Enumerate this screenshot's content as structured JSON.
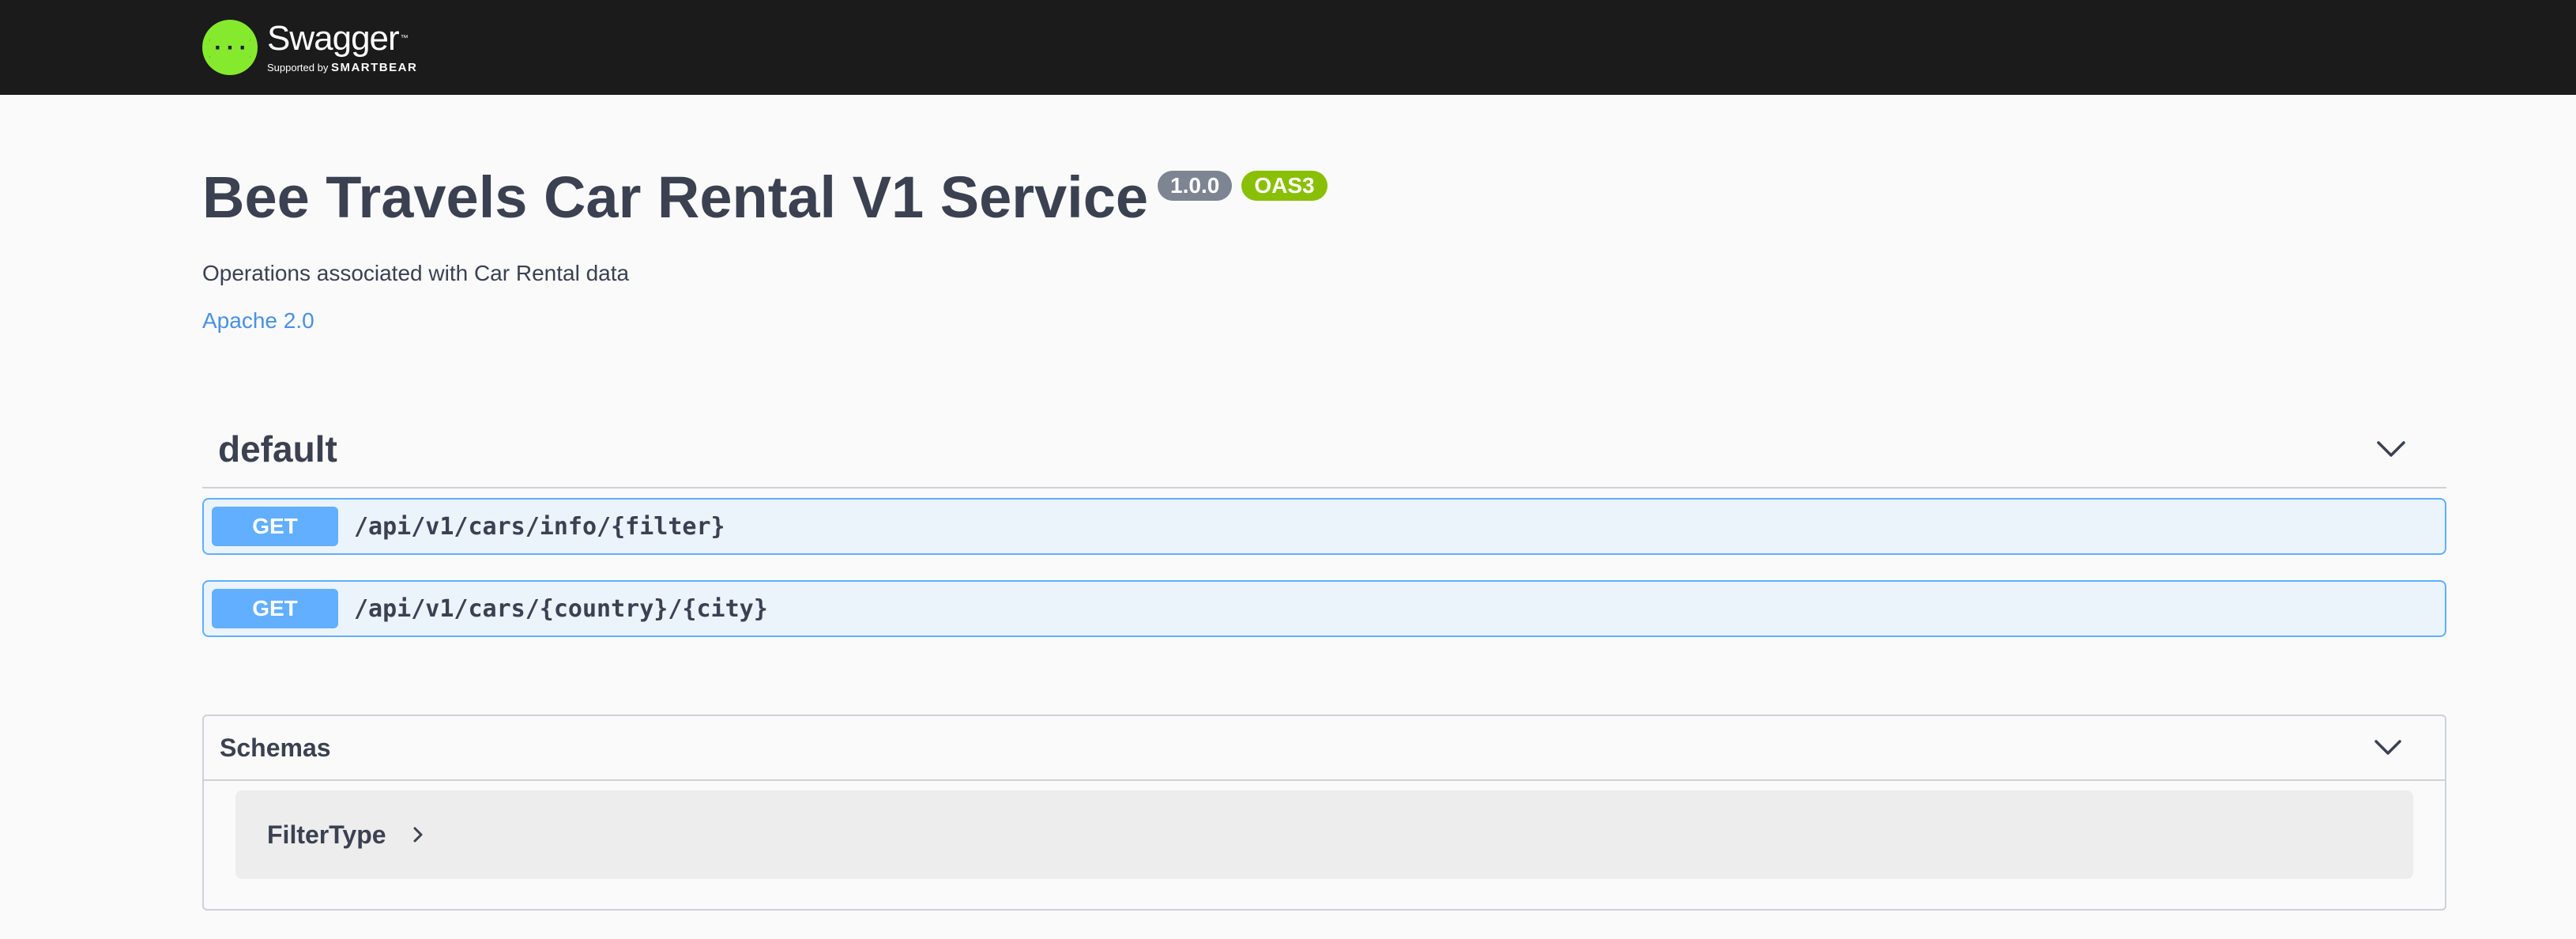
{
  "topbar": {
    "logo_name": "Swagger",
    "logo_tm": "™",
    "logo_supported_by": "Supported by ",
    "logo_brand": "SMARTBEAR",
    "logo_glyph": "{···}"
  },
  "info": {
    "title": "Bee Travels Car Rental V1 Service",
    "version": "1.0.0",
    "oas_badge": "OAS3",
    "description": "Operations associated with Car Rental data",
    "license": "Apache 2.0"
  },
  "tag": {
    "name": "default",
    "icon": "chevron-down-icon"
  },
  "operations": [
    {
      "method": "GET",
      "path": "/api/v1/cars/info/{filter}"
    },
    {
      "method": "GET",
      "path": "/api/v1/cars/{country}/{city}"
    }
  ],
  "schemas": {
    "title": "Schemas",
    "icon": "chevron-down-icon",
    "models": [
      {
        "name": "FilterType",
        "icon": "chevron-right-icon"
      }
    ]
  },
  "colors": {
    "topbar_bg": "#1b1b1b",
    "logo_green": "#85ea2d",
    "get_blue": "#61affe",
    "get_bg": "#ebf3fb",
    "version_badge": "#7d8492",
    "oas_badge": "#89bf04",
    "link": "#4990e2",
    "text": "#3b4151"
  }
}
